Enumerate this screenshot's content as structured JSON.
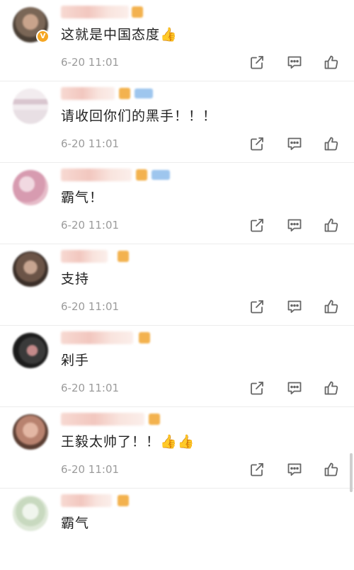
{
  "comments": [
    {
      "text": "这就是中国态度👍",
      "time": "6-20 11:01",
      "verified_badge": "V",
      "avatar_colors": [
        "#4a3f35",
        "#c9a48c",
        "#7a6656"
      ]
    },
    {
      "text": "请收回你们的黑手！！！",
      "time": "6-20 11:01",
      "avatar_colors": [
        "#e8dfe4",
        "#d9c6cf",
        "#f2ecef"
      ]
    },
    {
      "text": "霸气！",
      "time": "6-20 11:01",
      "avatar_colors": [
        "#e6bcc9",
        "#d79bb0",
        "#f1d9e1"
      ]
    },
    {
      "text": "支持",
      "time": "6-20 11:01",
      "avatar_colors": [
        "#6b5447",
        "#c7a591",
        "#3a2e28"
      ]
    },
    {
      "text": "剁手",
      "time": "6-20 11:01",
      "avatar_colors": [
        "#1c1c1c",
        "#c48a8a",
        "#3a3a3a"
      ]
    },
    {
      "text": "王毅太帅了！！👍👍",
      "time": "6-20 11:01",
      "avatar_colors": [
        "#b8826f",
        "#e3b7a4",
        "#5a3e33"
      ]
    },
    {
      "text": "霸气",
      "time": "",
      "avatar_colors": [
        "#dfe9d9",
        "#c8d9bf",
        "#f0f5ed"
      ]
    }
  ],
  "actions": {
    "share_icon": "share-icon",
    "comment_icon": "comment-icon",
    "like_icon": "thumbs-up-icon"
  },
  "colors": {
    "text": "#222222",
    "time": "#9b9b9b",
    "icon": "#666666",
    "badge": "#f5a623"
  }
}
